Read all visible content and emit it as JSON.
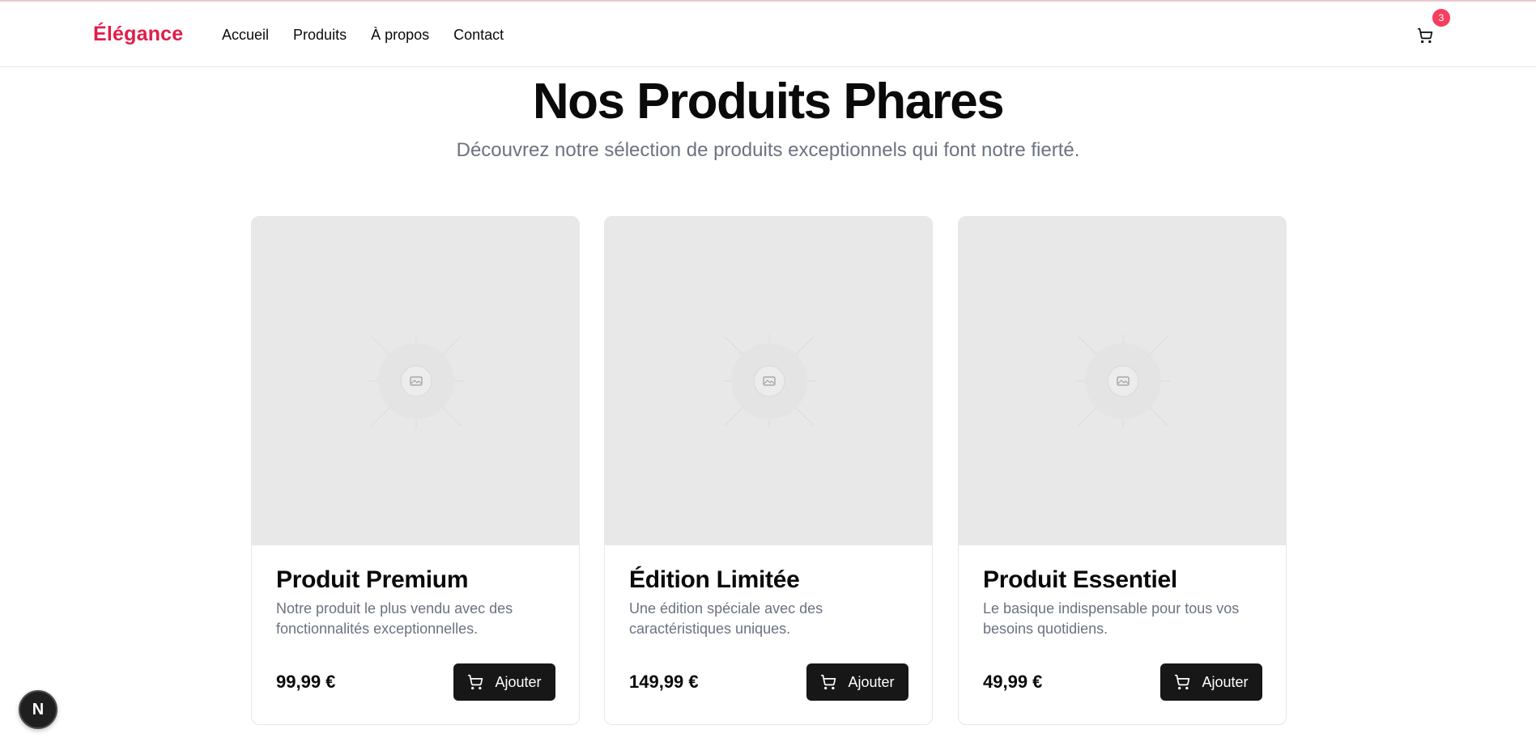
{
  "brand": {
    "logo": "Élégance",
    "accent_color": "#e11d48"
  },
  "nav": {
    "items": [
      {
        "label": "Accueil"
      },
      {
        "label": "Produits"
      },
      {
        "label": "À propos"
      },
      {
        "label": "Contact"
      }
    ]
  },
  "cart": {
    "icon": "cart-icon",
    "count": "3"
  },
  "hero": {
    "title": "Nos Produits Phares",
    "subtitle": "Découvrez notre sélection de produits exceptionnels qui font notre fierté."
  },
  "products": [
    {
      "title": "Produit Premium",
      "description": "Notre produit le plus vendu avec des fonctionnalités exceptionnelles.",
      "price": "99,99 €",
      "button_label": "Ajouter"
    },
    {
      "title": "Édition Limitée",
      "description": "Une édition spéciale avec des caractéristiques uniques.",
      "price": "149,99 €",
      "button_label": "Ajouter"
    },
    {
      "title": "Produit Essentiel",
      "description": "Le basique indispensable pour tous vos besoins quotidiens.",
      "price": "49,99 €",
      "button_label": "Ajouter"
    }
  ],
  "dev_tools": {
    "label": "N"
  }
}
